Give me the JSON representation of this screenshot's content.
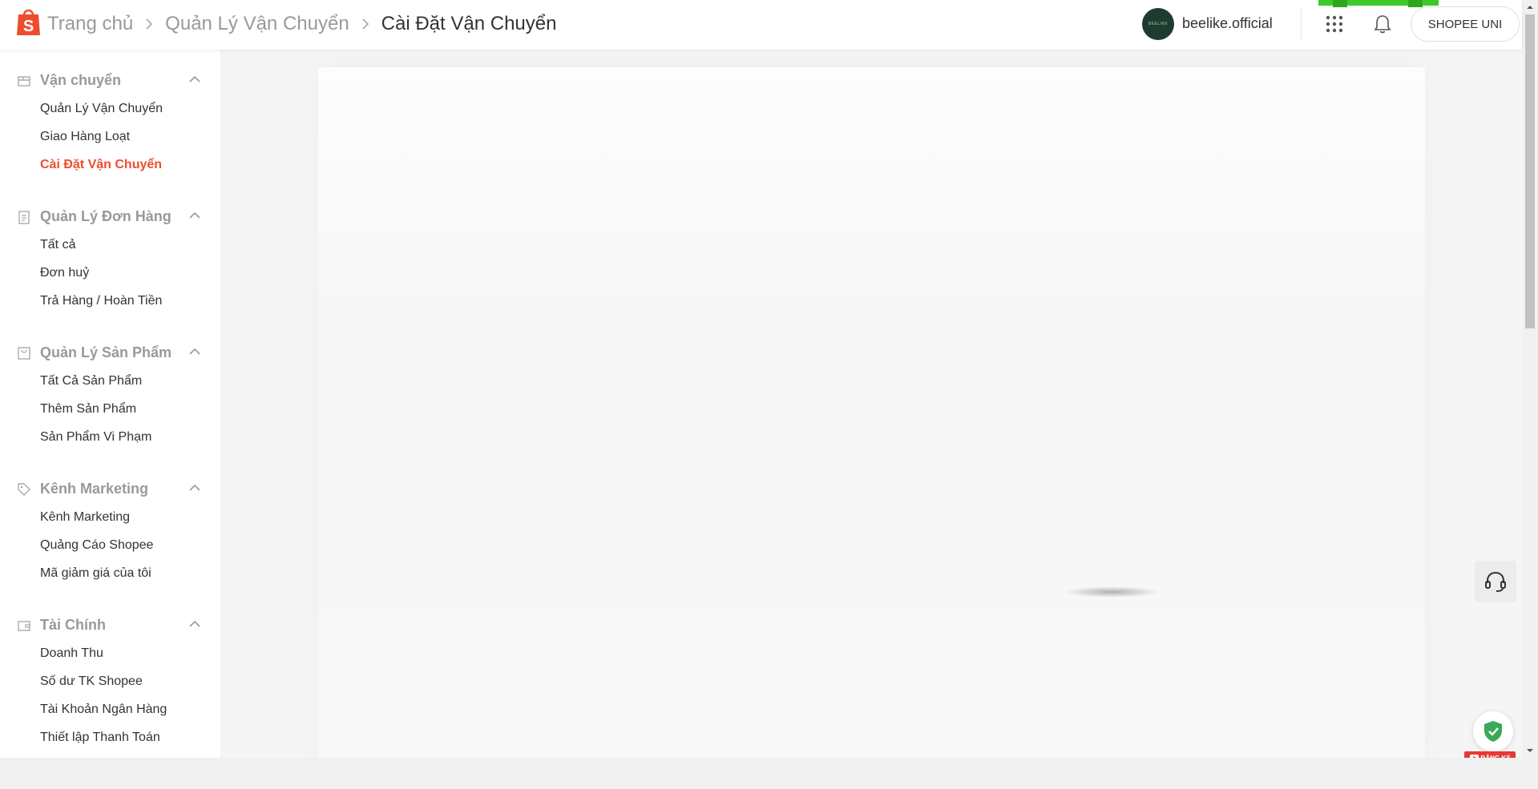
{
  "header": {
    "breadcrumbs": [
      {
        "label": "Trang chủ"
      },
      {
        "label": "Quản Lý Vận Chuyển"
      },
      {
        "label": "Cài Đặt Vận Chuyển"
      }
    ],
    "username": "beelike.official",
    "avatar_text": "BEELIKE",
    "uni_button": "SHOPEE UNI",
    "brand_color": "#ee4d2d"
  },
  "sidebar": {
    "sections": [
      {
        "title": "Vận chuyển",
        "icon": "truck-box-icon",
        "items": [
          "Quản Lý Vận Chuyển",
          "Giao Hàng Loạt",
          "Cài Đặt Vận Chuyển"
        ],
        "active_index": 2
      },
      {
        "title": "Quản Lý Đơn Hàng",
        "icon": "clipboard-icon",
        "items": [
          "Tất cả",
          "Đơn huỷ",
          "Trả Hàng / Hoàn Tiền"
        ]
      },
      {
        "title": "Quản Lý Sản Phẩm",
        "icon": "bag-icon",
        "items": [
          "Tất Cả Sản Phẩm",
          "Thêm Sản Phẩm",
          "Sản Phẩm Vi Phạm"
        ]
      },
      {
        "title": "Kênh Marketing",
        "icon": "tag-icon",
        "items": [
          "Kênh Marketing",
          "Quảng Cáo Shopee",
          "Mã giảm giá của tôi"
        ]
      },
      {
        "title": "Tài Chính",
        "icon": "wallet-icon",
        "items": [
          "Doanh Thu",
          "Số dư TK Shopee",
          "Tài Khoản Ngân Hàng",
          "Thiết lập Thanh Toán"
        ]
      }
    ]
  },
  "floating": {
    "subscribe_label": "ĐĂNG KÝ"
  }
}
